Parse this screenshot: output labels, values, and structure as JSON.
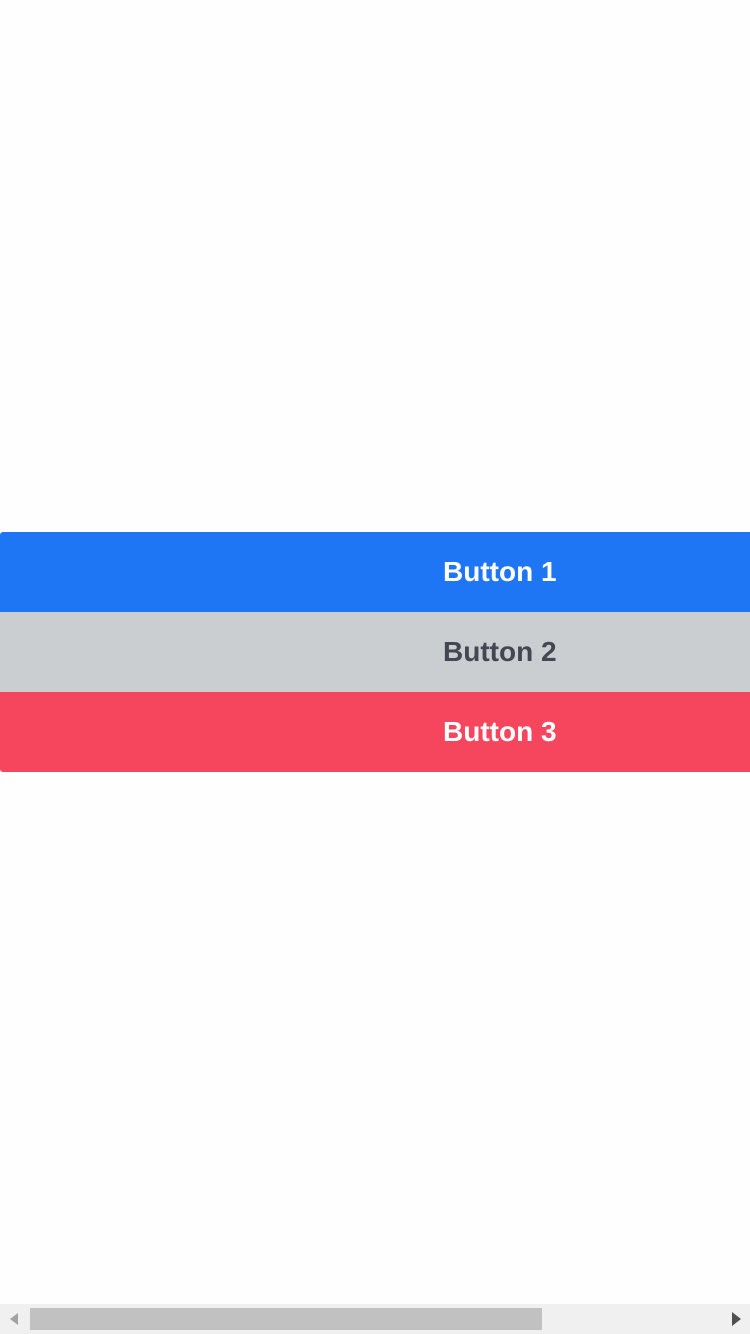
{
  "buttons": [
    {
      "label": "Button 1",
      "color": "#1e76f5"
    },
    {
      "label": "Button 2",
      "color": "#cbced1"
    },
    {
      "label": "Button 3",
      "color": "#f5465d"
    }
  ],
  "scrollbar": {
    "orientation": "horizontal",
    "left_icon": "scroll-left-arrow",
    "right_icon": "scroll-right-arrow",
    "position_fraction": 0.0,
    "visible_fraction": 0.68
  }
}
